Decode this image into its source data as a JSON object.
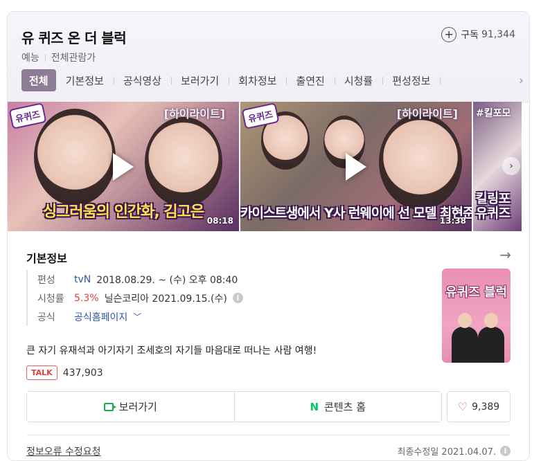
{
  "header": {
    "title": "유 퀴즈 온 더 블럭",
    "subscribe_label": "구독",
    "subscribe_count": "91,344",
    "genre": "예능",
    "rating": "전체관람가"
  },
  "tabs": [
    "전체",
    "기본정보",
    "공식영상",
    "보러가기",
    "회차정보",
    "출연진",
    "시청률",
    "편성정보"
  ],
  "videos": [
    {
      "badge": "유퀴즈",
      "tag": "[하이라이트]",
      "caption": "싱그러움의 인간화, 김고은",
      "duration": "08:18"
    },
    {
      "badge": "유퀴즈",
      "tag": "[하이라이트]",
      "caption": "카이스트생에서 Y사 런웨이에 선 모델 최현준",
      "duration": "13:38"
    },
    {
      "tag": "#킬포모",
      "caption": "킬링포 유퀴즈"
    }
  ],
  "info": {
    "section_title": "기본정보",
    "broadcast_label": "편성",
    "channel": "tvN",
    "schedule": "2018.08.29. ~ (수) 오후 08:40",
    "viewership_label": "시청률",
    "viewership_value": "5.3%",
    "viewership_source": "닐슨코리아 2021.09.15.(수)",
    "official_label": "공식",
    "official_link": "공식홈페이지",
    "description": "큰 자기 유재석과 아기자기 조세호의 자기들 마음대로 떠나는 사람 여행!",
    "talk_badge": "TALK",
    "talk_count": "437,903",
    "poster_title": "유퀴즈 블럭"
  },
  "actions": {
    "watch_label": "보러가기",
    "content_home_label": "콘텐츠 홈",
    "like_count": "9,389"
  },
  "footer": {
    "report_label": "정보오류 수정요청",
    "last_modified": "최종수정일 2021.04.07."
  }
}
